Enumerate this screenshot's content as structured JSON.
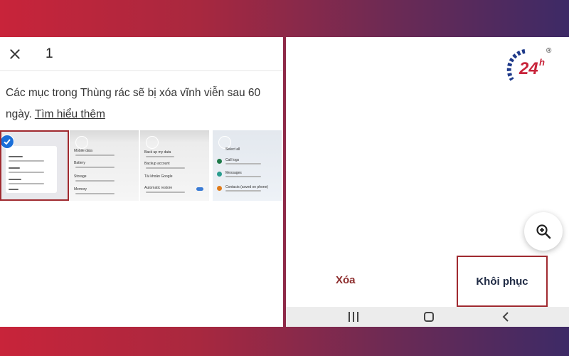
{
  "trash": {
    "selected_count": "1",
    "info_text": "Các mục trong Thùng rác sẽ bị xóa vĩnh viễn sau 60 ngày.",
    "learn_more": "Tìm hiểu thêm"
  },
  "thumbnails": [
    {
      "label": "screenshot-1",
      "selected": true
    },
    {
      "label": "screenshot-2",
      "selected": false,
      "rows": [
        "Mobile data",
        "Battery",
        "Storage",
        "Memory"
      ]
    },
    {
      "label": "screenshot-3",
      "selected": false,
      "rows": [
        "Back up my data",
        "Backup account",
        "Tài khoản Google",
        "Automatic restore"
      ]
    },
    {
      "label": "screenshot-4",
      "selected": false,
      "rows": [
        "Select all",
        "Call logs",
        "Messages",
        "Contacts (saved on phone)"
      ]
    }
  ],
  "actions": {
    "delete_label": "Xóa",
    "restore_label": "Khôi phục"
  },
  "logo": {
    "text": "24h",
    "mark": "®"
  },
  "colors": {
    "accent_red": "#a02a30",
    "check_blue": "#1a6ed8",
    "delete_text": "#8c2b2b",
    "restore_text": "#1f2a44"
  },
  "icons": {
    "close": "close-icon",
    "zoom": "zoom-in-icon",
    "check": "check-icon",
    "recent": "recent-apps-icon",
    "home": "home-icon",
    "back": "back-icon"
  }
}
